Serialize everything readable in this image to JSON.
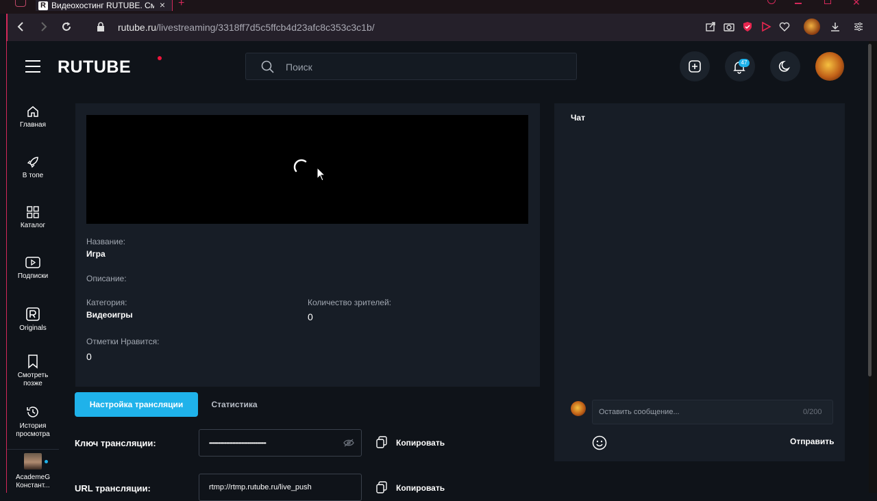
{
  "browser": {
    "tab_title": "Видеохостинг RUTUBE. См",
    "tab_favicon": "R",
    "url_host": "rutube.ru",
    "url_path": "/livestreaming/3318ff7d5c5ffcb4d23afc8c353c3c1b/"
  },
  "header": {
    "logo": "RUTUBE",
    "search_placeholder": "Поиск",
    "notifications_count": "47"
  },
  "sidebar": {
    "items": [
      {
        "label": "Главная",
        "icon": "home-icon"
      },
      {
        "label": "В топе",
        "icon": "rocket-icon"
      },
      {
        "label": "Каталог",
        "icon": "grid-icon"
      },
      {
        "label": "Подписки",
        "icon": "subscriptions-icon"
      },
      {
        "label": "Originals",
        "icon": "originals-icon"
      },
      {
        "label": "Смотреть позже",
        "icon": "bookmark-icon"
      },
      {
        "label": "История просмотра",
        "icon": "history-icon"
      }
    ],
    "user_name": "AcademeG Констант..."
  },
  "stream": {
    "title_label": "Название:",
    "title_value": "Игра",
    "description_label": "Описание:",
    "category_label": "Категория:",
    "category_value": "Видеоигры",
    "viewers_label": "Количество зрителей:",
    "viewers_value": "0",
    "likes_label": "Отметки Нравится:",
    "likes_value": "0"
  },
  "tabs": {
    "settings": "Настройка трансляции",
    "stats": "Статистика"
  },
  "form": {
    "key_label": "Ключ трансляции:",
    "key_value": "••••••••••••••••••••••••••••••••••••••••••••••",
    "copy_label": "Копировать",
    "url_label": "URL трансляции:",
    "url_value": "rtmp://rtmp.rutube.ru/live_push"
  },
  "chat": {
    "title": "Чат",
    "input_placeholder": "Оставить сообщение...",
    "counter": "0/200",
    "send_label": "Отправить"
  },
  "colors": {
    "accent": "#1fb2ea",
    "logo_dot": "#ed143b",
    "frame": "#d4285a"
  }
}
